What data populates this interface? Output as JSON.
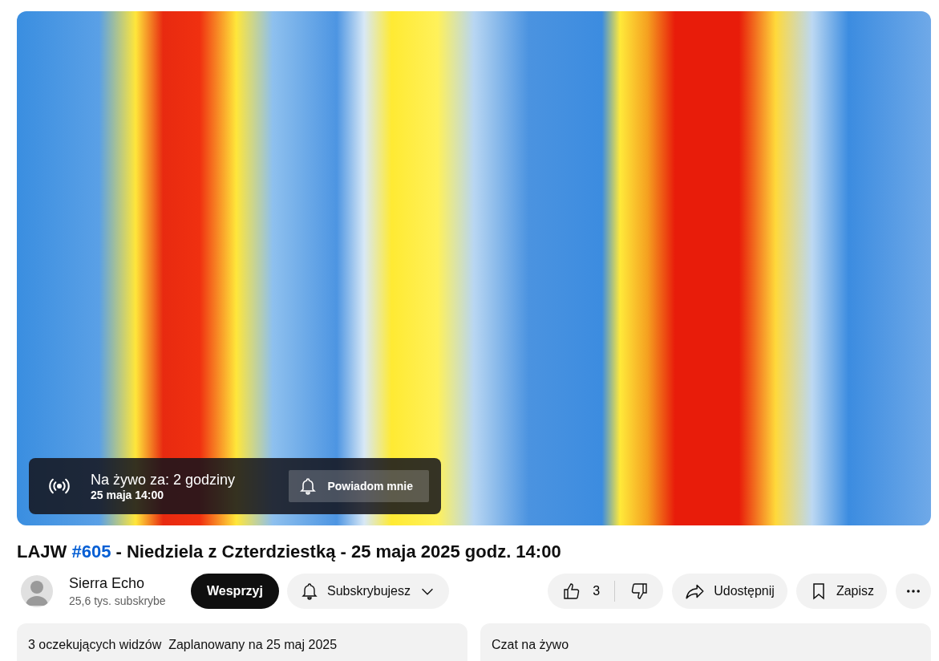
{
  "player": {
    "overlay": {
      "title": "Na żywo za: 2 godziny",
      "date": "25 maja 14:00",
      "button": "Powiadom mnie"
    }
  },
  "title": {
    "prefix": "LAJW",
    "hashtag": "#605",
    "rest": "- Niedziela z Czterdziestką - 25 maja 2025 godz. 14:00"
  },
  "channel": {
    "name": "Sierra Echo",
    "subscribers": "25,6 tys. subskrybe"
  },
  "buttons": {
    "support": "Wesprzyj",
    "subscribe": "Subskrybujesz",
    "likes": "3",
    "share": "Udostępnij",
    "save": "Zapisz"
  },
  "description": {
    "text": "3 oczekujących widzów  Zaplanowany na 25 maj 2025"
  },
  "chat": {
    "title": "Czat na żywo"
  }
}
